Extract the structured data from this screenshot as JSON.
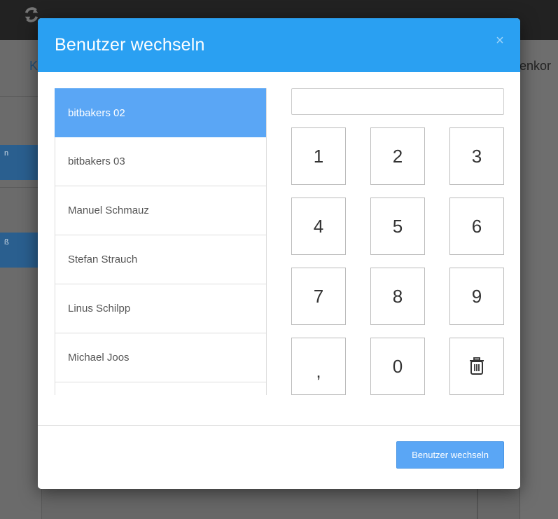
{
  "background": {
    "tab_left_fragment": "K",
    "tab_right_fragment": "enkor",
    "left_blue_item_1": "n",
    "left_blue_item_2": "ß"
  },
  "modal": {
    "title": "Benutzer wechseln",
    "close_glyph": "×",
    "users": [
      {
        "name": "bitbakers 02",
        "selected": true
      },
      {
        "name": "bitbakers 03",
        "selected": false
      },
      {
        "name": "Manuel Schmauz",
        "selected": false
      },
      {
        "name": "Stefan Strauch",
        "selected": false
      },
      {
        "name": "Linus Schilpp",
        "selected": false
      },
      {
        "name": "Michael Joos",
        "selected": false
      }
    ],
    "pin": {
      "value": "",
      "placeholder": ""
    },
    "keypad": {
      "keys": [
        "1",
        "2",
        "3",
        "4",
        "5",
        "6",
        "7",
        "8",
        "9",
        ",",
        "0"
      ],
      "delete_icon": "trash-icon"
    },
    "footer": {
      "submit_label": "Benutzer wechseln"
    }
  },
  "colors": {
    "header": "#2aa0f2",
    "selected_item": "#5aa6f5",
    "button": "#5aa6f5"
  }
}
